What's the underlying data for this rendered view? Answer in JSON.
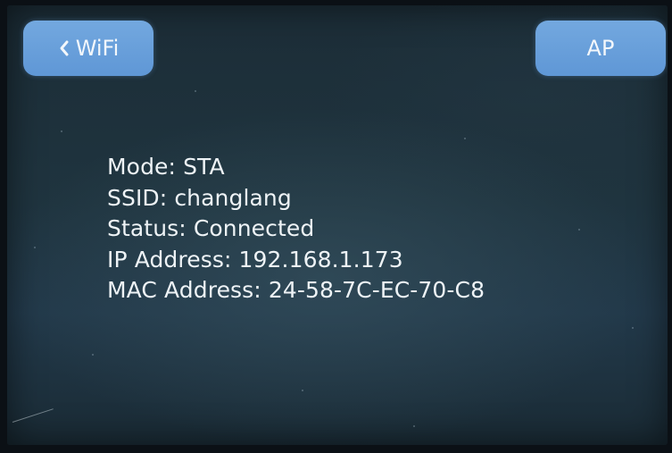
{
  "nav": {
    "back_label": "WiFi",
    "back_icon": "chevron-left-icon",
    "ap_label": "AP"
  },
  "status": {
    "mode": "Mode: STA",
    "ssid": "SSID: changlang",
    "state": "Status: Connected",
    "ip": "IP Address: 192.168.1.173",
    "mac": "MAC Address: 24-58-7C-EC-70-C8"
  },
  "colors": {
    "button": "#6a9fdb",
    "screen": "#1f343f",
    "text": "#eef3f6"
  }
}
